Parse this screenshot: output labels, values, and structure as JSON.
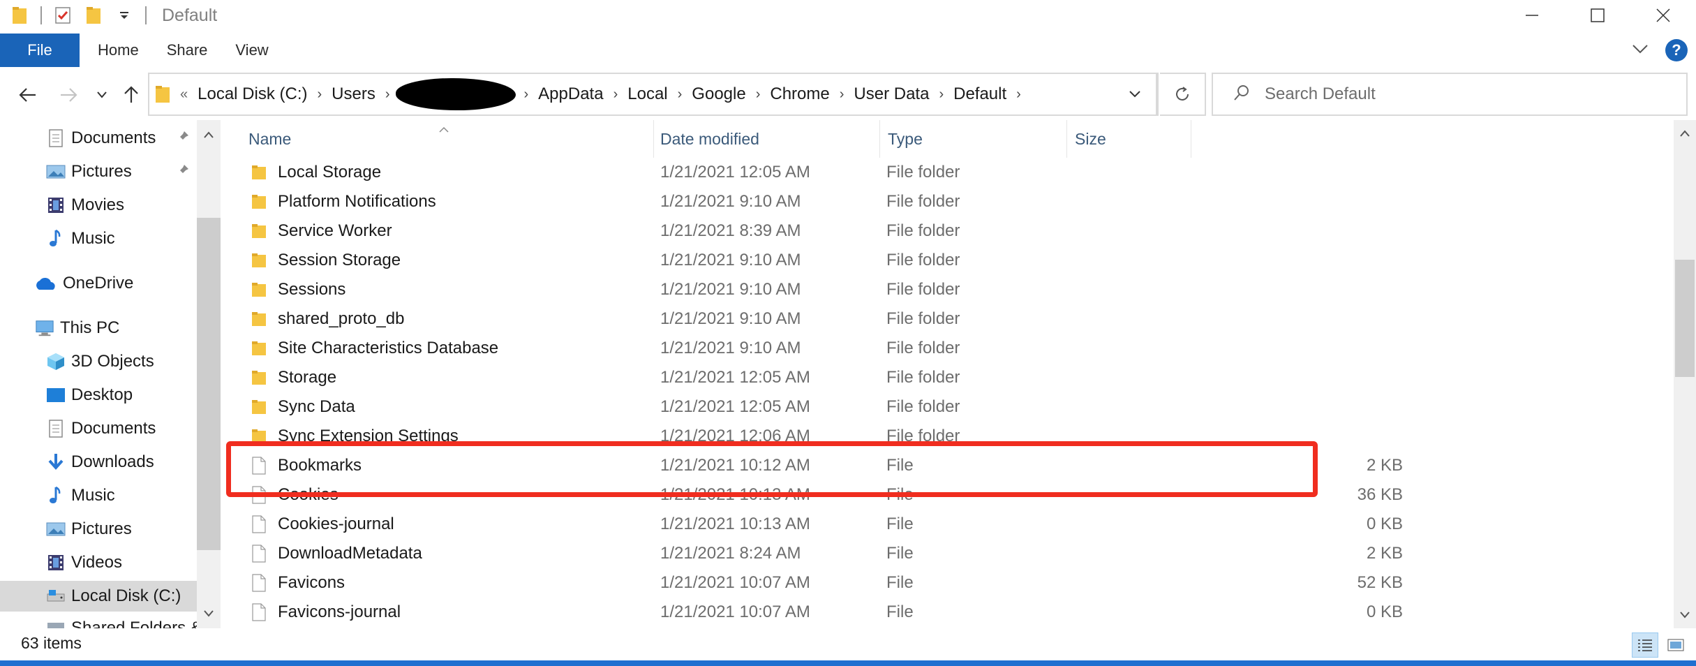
{
  "window": {
    "title": "Default"
  },
  "ribbon": {
    "file_label": "File",
    "tabs": [
      "Home",
      "Share",
      "View"
    ]
  },
  "address": {
    "crumbs": [
      "Local Disk (C:)",
      "Users",
      "AppData",
      "Local",
      "Google",
      "Chrome",
      "User Data",
      "Default"
    ]
  },
  "search": {
    "placeholder": "Search Default"
  },
  "nav": {
    "items": [
      {
        "label": "Documents",
        "icon": "documents-icon"
      },
      {
        "label": "Pictures",
        "icon": "pictures-icon"
      },
      {
        "label": "Movies",
        "icon": "video-icon"
      },
      {
        "label": "Music",
        "icon": "music-icon"
      },
      {
        "label": "OneDrive",
        "icon": "onedrive-cloud-icon"
      },
      {
        "label": "This PC",
        "icon": "this-pc-icon"
      },
      {
        "label": "3D Objects",
        "icon": "3d-objects-icon"
      },
      {
        "label": "Desktop",
        "icon": "desktop-icon"
      },
      {
        "label": "Documents",
        "icon": "documents-icon"
      },
      {
        "label": "Downloads",
        "icon": "downloads-icon"
      },
      {
        "label": "Music",
        "icon": "music-icon"
      },
      {
        "label": "Pictures",
        "icon": "pictures-icon"
      },
      {
        "label": "Videos",
        "icon": "video-icon"
      },
      {
        "label": "Local Disk (C:)",
        "icon": "local-disk-icon"
      },
      {
        "label": "Shared Folders &",
        "icon": "shared-folder-icon"
      }
    ]
  },
  "columns": {
    "name": "Name",
    "date": "Date modified",
    "type": "Type",
    "size": "Size"
  },
  "files": [
    {
      "name": "Local Storage",
      "date": "1/21/2021 12:05 AM",
      "type": "File folder",
      "size": "",
      "kind": "folder"
    },
    {
      "name": "Platform Notifications",
      "date": "1/21/2021 9:10 AM",
      "type": "File folder",
      "size": "",
      "kind": "folder"
    },
    {
      "name": "Service Worker",
      "date": "1/21/2021 8:39 AM",
      "type": "File folder",
      "size": "",
      "kind": "folder"
    },
    {
      "name": "Session Storage",
      "date": "1/21/2021 9:10 AM",
      "type": "File folder",
      "size": "",
      "kind": "folder"
    },
    {
      "name": "Sessions",
      "date": "1/21/2021 9:10 AM",
      "type": "File folder",
      "size": "",
      "kind": "folder"
    },
    {
      "name": "shared_proto_db",
      "date": "1/21/2021 9:10 AM",
      "type": "File folder",
      "size": "",
      "kind": "folder"
    },
    {
      "name": "Site Characteristics Database",
      "date": "1/21/2021 9:10 AM",
      "type": "File folder",
      "size": "",
      "kind": "folder"
    },
    {
      "name": "Storage",
      "date": "1/21/2021 12:05 AM",
      "type": "File folder",
      "size": "",
      "kind": "folder"
    },
    {
      "name": "Sync Data",
      "date": "1/21/2021 12:05 AM",
      "type": "File folder",
      "size": "",
      "kind": "folder"
    },
    {
      "name": "Sync Extension Settings",
      "date": "1/21/2021 12:06 AM",
      "type": "File folder",
      "size": "",
      "kind": "folder"
    },
    {
      "name": "Bookmarks",
      "date": "1/21/2021 10:12 AM",
      "type": "File",
      "size": "2 KB",
      "kind": "file"
    },
    {
      "name": "Cookies",
      "date": "1/21/2021 10:13 AM",
      "type": "File",
      "size": "36 KB",
      "kind": "file"
    },
    {
      "name": "Cookies-journal",
      "date": "1/21/2021 10:13 AM",
      "type": "File",
      "size": "0 KB",
      "kind": "file"
    },
    {
      "name": "DownloadMetadata",
      "date": "1/21/2021 8:24 AM",
      "type": "File",
      "size": "2 KB",
      "kind": "file"
    },
    {
      "name": "Favicons",
      "date": "1/21/2021 10:07 AM",
      "type": "File",
      "size": "52 KB",
      "kind": "file"
    },
    {
      "name": "Favicons-journal",
      "date": "1/21/2021 10:07 AM",
      "type": "File",
      "size": "0 KB",
      "kind": "file"
    }
  ],
  "status": {
    "item_count": "63 items"
  },
  "colors": {
    "accent": "#1a64b8",
    "highlight": "#f02d1f",
    "folder": "#f5c542"
  }
}
